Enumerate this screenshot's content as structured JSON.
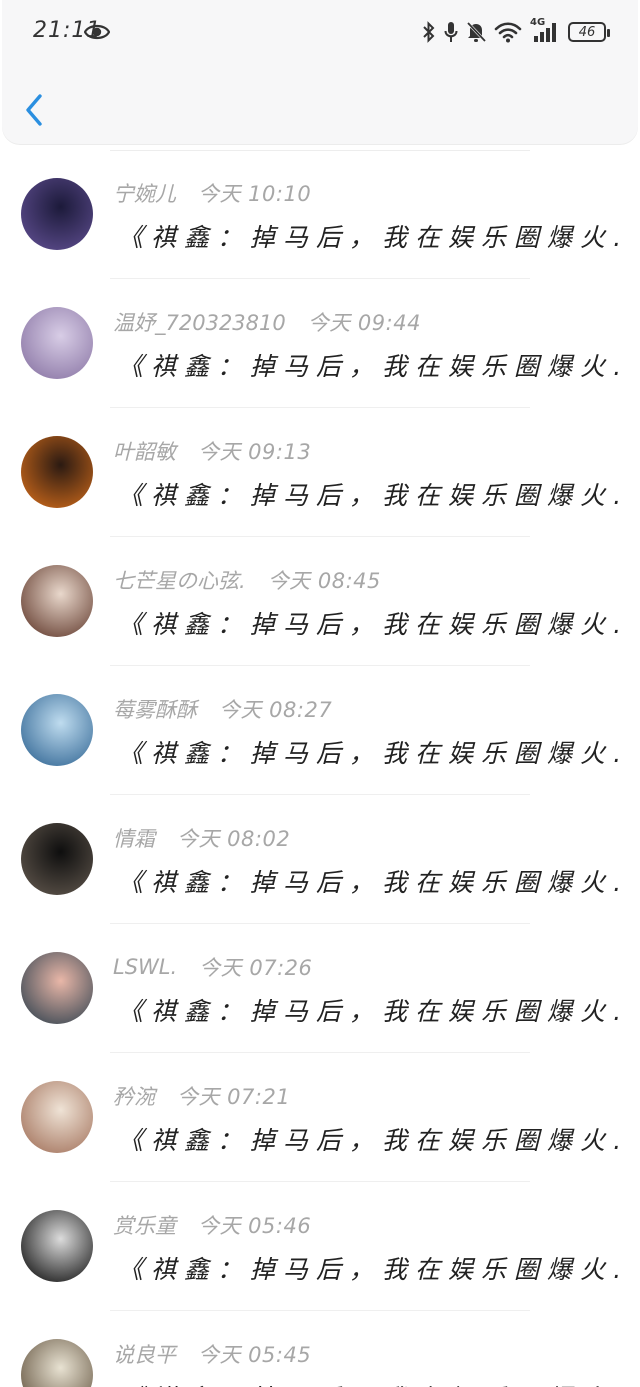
{
  "status_bar": {
    "time": "21:11",
    "network": "4G",
    "battery": "46",
    "icons": [
      "eye-icon",
      "bluetooth-icon",
      "mic-icon",
      "bell-off-icon",
      "wifi-icon",
      "signal-icon",
      "battery-icon"
    ]
  },
  "header": {
    "back_icon": "chevron-left-icon",
    "accent_color": "#2b8fe0"
  },
  "messages": [
    {
      "name": "宁婉儿",
      "time": "今天 10:10",
      "text": "《祺鑫：掉马后，我在娱乐圈爆火…",
      "avatar_colors": [
        "#1c1a3a",
        "#5a4a8a"
      ]
    },
    {
      "name": "温妤_720323810",
      "time": "今天 09:44",
      "text": "《祺鑫：掉马后，我在娱乐圈爆火…",
      "avatar_colors": [
        "#d8cde6",
        "#8e7aa8"
      ]
    },
    {
      "name": "叶韶敏",
      "time": "今天 09:13",
      "text": "《祺鑫：掉马后，我在娱乐圈爆火…",
      "avatar_colors": [
        "#2b1a12",
        "#c2641a"
      ]
    },
    {
      "name": "七芒星の心弦.",
      "time": "今天 08:45",
      "text": "《祺鑫：掉马后，我在娱乐圈爆火…",
      "avatar_colors": [
        "#e9d8cc",
        "#6b4538"
      ]
    },
    {
      "name": "莓雾酥酥",
      "time": "今天 08:27",
      "text": "《祺鑫：掉马后，我在娱乐圈爆火…",
      "avatar_colors": [
        "#bfdcef",
        "#3b6e9a"
      ]
    },
    {
      "name": "情霜",
      "time": "今天 08:02",
      "text": "《祺鑫：掉马后，我在娱乐圈爆火…",
      "avatar_colors": [
        "#0e0e0e",
        "#5a5148"
      ]
    },
    {
      "name": "LSWL.",
      "time": "今天 07:26",
      "text": "《祺鑫：掉马后，我在娱乐圈爆火…",
      "avatar_colors": [
        "#e9b7a8",
        "#3e4a55"
      ]
    },
    {
      "name": "矜涴",
      "time": "今天 07:21",
      "text": "《祺鑫：掉马后，我在娱乐圈爆火…",
      "avatar_colors": [
        "#efe3d6",
        "#a87a64"
      ]
    },
    {
      "name": "赏乐童",
      "time": "今天 05:46",
      "text": "《祺鑫：掉马后，我在娱乐圈爆火…",
      "avatar_colors": [
        "#dcdcdc",
        "#1e1e1e"
      ]
    },
    {
      "name": "说良平",
      "time": "今天 05:45",
      "text": "《祺鑫：掉马后，我在娱乐圈爆火…",
      "avatar_colors": [
        "#e8e2d2",
        "#6b5c48"
      ]
    }
  ]
}
